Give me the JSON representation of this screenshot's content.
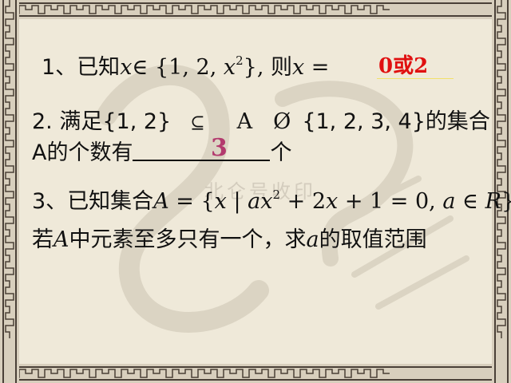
{
  "questions": {
    "q1": {
      "number": "1、",
      "prefix": "已知",
      "var_x": "x",
      "set_start": "∈ {1, 2, ",
      "x2_base": "x",
      "x2_exp": "2",
      "set_end": "}, ",
      "then": "则",
      "var_x2": "x",
      "equals": " =",
      "answer": "0或2"
    },
    "q2": {
      "line1": "2. 满足{1, 2}",
      "subset_sym": "⊆",
      "set_a": "A",
      "empty_sym": "Ø",
      "set_right": "{1, 2, 3, 4}的集合",
      "line2_prefix": "A的个数有",
      "line2_suffix": "个",
      "answer": "3"
    },
    "q3": {
      "number": "3、",
      "prefix": "已知集合",
      "set_name": "A",
      "def_start": " = {",
      "x": "x",
      "bar": " | ",
      "ax": "ax",
      "ax_exp": "2",
      "middle": " + 2",
      "x2": "x",
      "end": " + 1 = 0, ",
      "a": "a",
      "in_r": " ∈ ",
      "r": "R",
      "close": "},",
      "line2_prefix": "若",
      "line2_a": "A",
      "line2_mid": "中元素至多只有一个，求",
      "line2_var": "a",
      "line2_suffix": "的取值范围"
    }
  },
  "watermark": "北仑号收印",
  "colors": {
    "background": "#efe9d9",
    "answer_red": "#e01010",
    "answer_pink": "#b33a6e",
    "border_dark": "#4a4037",
    "border_light": "#d8cfbd"
  }
}
